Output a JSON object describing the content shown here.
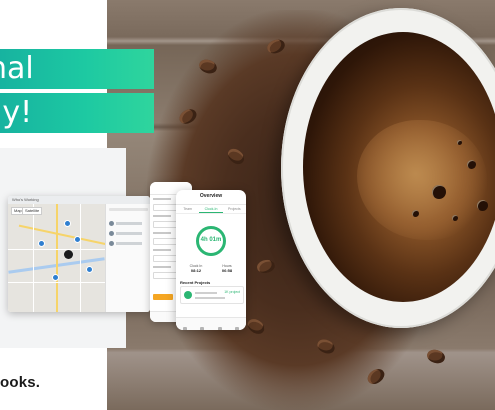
{
  "banner": {
    "headline_line1": "nal",
    "headline_line2": "ay!",
    "brand": "ooks.",
    "accent_color": "#1dc9a2"
  },
  "desktop_window": {
    "title": "Who's Working",
    "map_controls": [
      "Map",
      "Satellite"
    ]
  },
  "phone_overview": {
    "title": "Overview",
    "tabs": [
      "Team",
      "Clock-In",
      "Projects"
    ],
    "timer": "4h 01m",
    "stats": [
      {
        "label": "Clock In",
        "value": "08:12"
      },
      {
        "label": "Hours",
        "value": "06:58"
      }
    ],
    "section_title": "Recent Projects",
    "project_amount": "1K project"
  }
}
